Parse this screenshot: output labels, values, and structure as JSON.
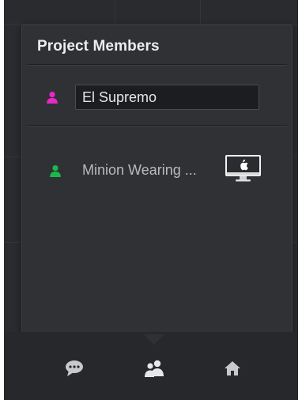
{
  "popover": {
    "title": "Project Members"
  },
  "current_user": {
    "name_value": "El Supremo",
    "icon": "person-icon",
    "icon_color": "#e629c8"
  },
  "members": [
    {
      "name": "Minion Wearing ...",
      "icon": "person-icon",
      "icon_color": "#19b94a",
      "device": "mac-desktop-icon"
    }
  ],
  "bottom_nav": {
    "items": [
      {
        "name": "chat",
        "icon": "chat-bubble-icon",
        "selected": false
      },
      {
        "name": "members",
        "icon": "people-icon",
        "selected": true
      },
      {
        "name": "home",
        "icon": "home-icon",
        "selected": false
      }
    ],
    "icon_color": "#c8c9cc"
  },
  "colors": {
    "background": "#2a2b2e",
    "popover": "#2f3135",
    "text_primary": "#eceded",
    "text_secondary": "#b9babd"
  }
}
